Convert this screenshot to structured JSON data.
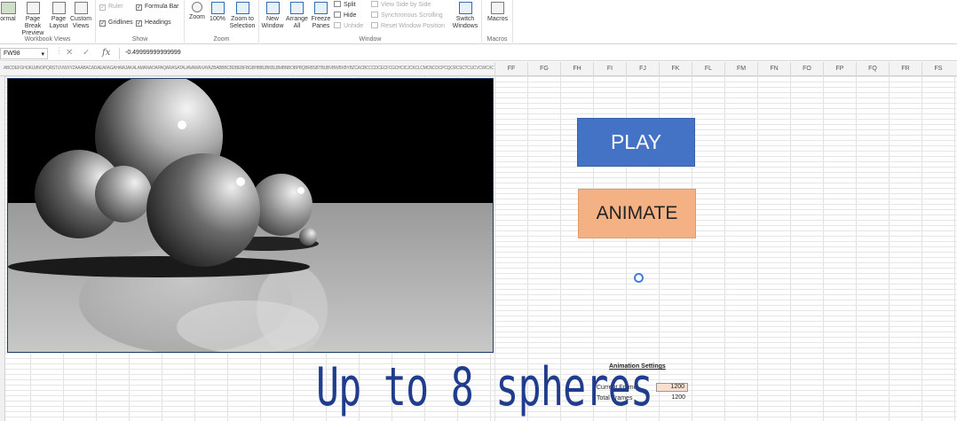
{
  "ribbon": {
    "workbook_views": {
      "label": "Workbook Views",
      "buttons": [
        "ormal",
        "Page Break\nPreview",
        "Page\nLayout",
        "Custom\nViews"
      ]
    },
    "show": {
      "label": "Show",
      "ruler": "Ruler",
      "formula_bar": "Formula Bar",
      "gridlines": "Gridlines",
      "headings": "Headings"
    },
    "zoom": {
      "label": "Zoom",
      "zoom": "Zoom",
      "hundred": "100%",
      "to_selection": "Zoom to\nSelection"
    },
    "window": {
      "label": "Window",
      "new_window": "New\nWindow",
      "arrange_all": "Arrange\nAll",
      "freeze_panes": "Freeze\nPanes",
      "split": "Split",
      "hide": "Hide",
      "unhide": "Unhide",
      "view_side_by_side": "View Side by Side",
      "synchronous_scrolling": "Synchronous Scrolling",
      "reset_window_position": "Reset Window Position",
      "switch_windows": "Switch\nWindows"
    },
    "macros": {
      "label": "Macros",
      "macros": "Macros"
    }
  },
  "formula_bar": {
    "name_box": "FW98",
    "value": "-0.49999999999999"
  },
  "columns": {
    "strip": "ABCDEFGHIJKLMNOPQRSTUVWXYZAAABACADAEAFAGAHAIAJAKALAMANAOAPAQARASATAUAVAWAXAYAZBABBBCBDBEBFBGBHBIBJBKBLBMBNBOBPBQBRBSBTBUBVBWBXBYBZCACBCCCDCECFCGCHCICJCKCLCMCNCOCPCQCRCSCTCUCVCWCXCYCZDADBDCDDDEDFDGDHDIDJDKDLDMDNDODPDQDRDSDTDUDVDWDXDYDZEAEBECEDEEEFEGEHEIEJEKELEMENEOEPEQERESETEUEVEWEXEYEZFAFBFCFDFE",
    "labels": [
      "FF",
      "FG",
      "FH",
      "FI",
      "FJ",
      "FK",
      "FL",
      "FM",
      "FN",
      "FO",
      "FP",
      "FQ",
      "FR",
      "FS"
    ]
  },
  "buttons": {
    "play": "PLAY",
    "animate": "ANIMATE"
  },
  "animation_settings": {
    "title": "Animation Settings",
    "current_frame_label": "Current Frame",
    "current_frame_value": "1200",
    "total_frames_label": "Total Frames",
    "total_frames_value": "1200"
  },
  "caption": "Up to 8 spheres"
}
